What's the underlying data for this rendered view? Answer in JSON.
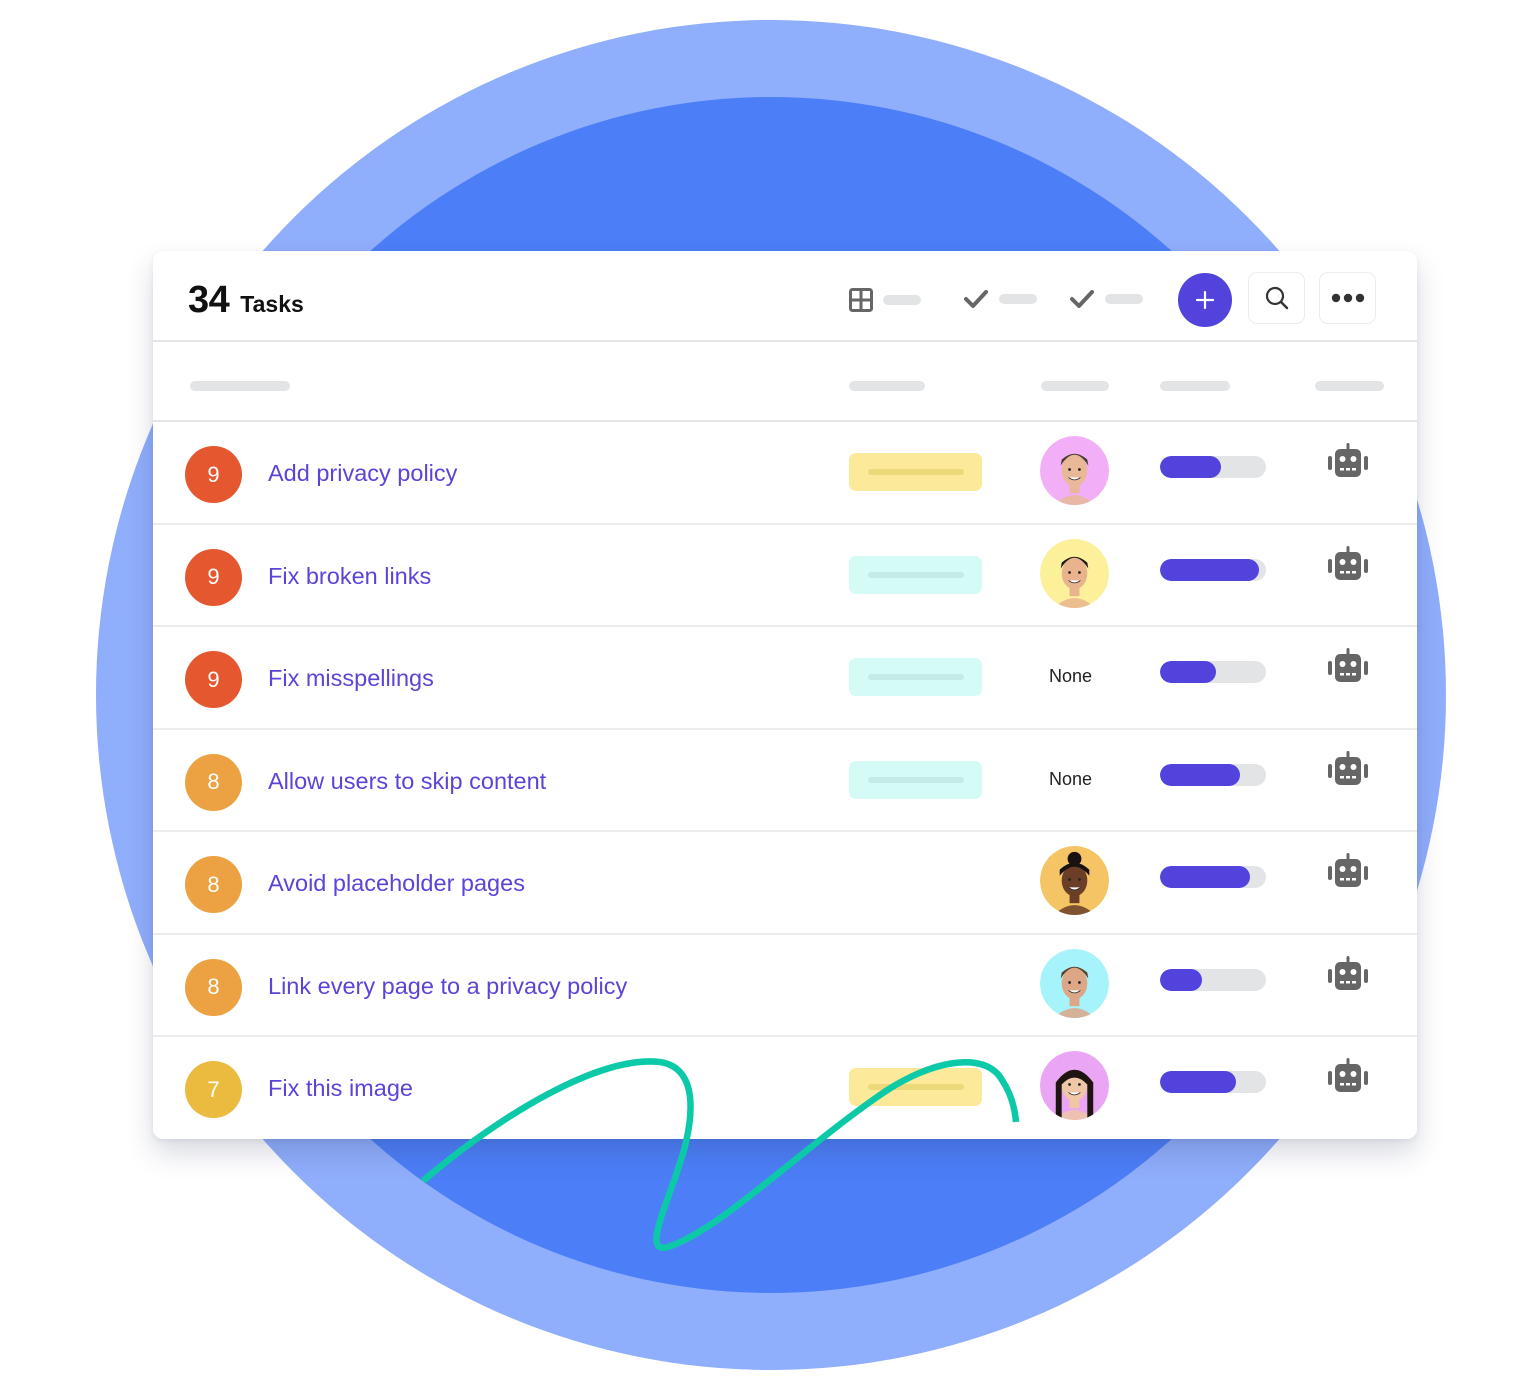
{
  "header": {
    "task_count": "34",
    "task_label": "Tasks",
    "view_filters": [
      {
        "icon": "grid-icon"
      },
      {
        "icon": "check-icon"
      },
      {
        "icon": "check-icon"
      }
    ],
    "buttons": {
      "add": {
        "icon": "plus-icon"
      },
      "search": {
        "icon": "search-icon"
      },
      "more": {
        "icon": "more-horizontal-icon"
      }
    }
  },
  "colors": {
    "accent": "#5143dc",
    "task_link": "#5a45d8",
    "priority_9": "#e5572f",
    "priority_8": "#eca142",
    "priority_7": "#ebbb40",
    "circle_outer": "#8faefb",
    "circle_inner": "#4c7ef7",
    "squiggle": "#0cc9a8"
  },
  "tasks": [
    {
      "priority": "9",
      "name": "Add privacy policy",
      "tag": "yellow",
      "assignee": {
        "type": "avatar",
        "bg": "#f2aef7",
        "skin": "#e8b898",
        "hair": "#4a3a2e",
        "style": "short"
      },
      "progress": 0.58,
      "automation_icon": "robot-icon"
    },
    {
      "priority": "9",
      "name": "Fix broken links",
      "tag": "cyan",
      "assignee": {
        "type": "avatar",
        "bg": "#fdf09a",
        "skin": "#e9b48d",
        "hair": "#1f1a17",
        "style": "short"
      },
      "progress": 0.93,
      "automation_icon": "robot-icon"
    },
    {
      "priority": "9",
      "name": "Fix misspellings",
      "tag": "cyan",
      "assignee": {
        "type": "none",
        "label": "None"
      },
      "progress": 0.53,
      "automation_icon": "robot-icon"
    },
    {
      "priority": "8",
      "name": "Allow users to skip content",
      "tag": "cyan",
      "assignee": {
        "type": "none",
        "label": "None"
      },
      "progress": 0.75,
      "automation_icon": "robot-icon"
    },
    {
      "priority": "8",
      "name": "Avoid placeholder pages",
      "tag": "",
      "assignee": {
        "type": "avatar",
        "bg": "#f5c465",
        "skin": "#6b3f27",
        "hair": "#1a1210",
        "style": "bun"
      },
      "progress": 0.85,
      "automation_icon": "robot-icon"
    },
    {
      "priority": "8",
      "name": "Link every page to a privacy policy",
      "tag": "",
      "assignee": {
        "type": "avatar",
        "bg": "#a6f3fb",
        "skin": "#dca687",
        "hair": "#5b3f2b",
        "style": "short"
      },
      "progress": 0.4,
      "automation_icon": "robot-icon"
    },
    {
      "priority": "7",
      "name": "Fix this image",
      "tag": "yellow",
      "assignee": {
        "type": "avatar",
        "bg": "#eaa5f5",
        "skin": "#efc6a6",
        "hair": "#1e1512",
        "style": "long"
      },
      "progress": 0.72,
      "automation_icon": "robot-icon"
    }
  ]
}
